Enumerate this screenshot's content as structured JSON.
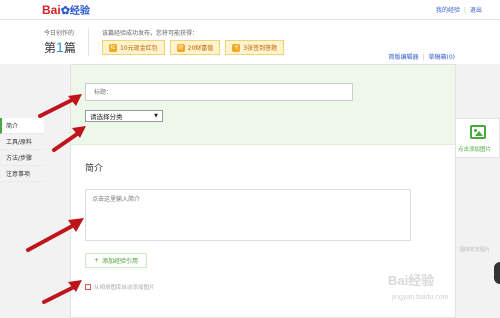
{
  "logo": {
    "brand": "Bai",
    "paw": "✿",
    "suffix": "经验"
  },
  "toplinks": {
    "my_exp": "我的经验",
    "logout": "退出"
  },
  "header": {
    "today_label": "今日创作的",
    "count_prefix": "第",
    "count_num": "1",
    "count_suffix": "篇",
    "hint": "该篇经验成功发布，您将可能获得：",
    "rewards": [
      {
        "icon": "红",
        "label": "10元现金红包"
      },
      {
        "icon": "财",
        "label": "20财富值"
      },
      {
        "icon": "卡",
        "label": "3张签到答题"
      }
    ],
    "simple_editor": "简版编辑器",
    "drafts": "草稿箱(0)"
  },
  "form": {
    "title_placeholder": "标题：",
    "category_label": "请选择分类",
    "category_arrow": "▼",
    "section_title": "简介",
    "intro_placeholder": "点击这里输入简介",
    "add_ref_plus": "+",
    "add_ref_label": "添加经验引用",
    "auto_add": "从相册图库自动添加图片"
  },
  "leftnav": {
    "items": [
      {
        "label": "简介",
        "active": true
      },
      {
        "label": "工具/原料",
        "active": false
      },
      {
        "label": "方法/步骤",
        "active": false
      },
      {
        "label": "注意事项",
        "active": false
      }
    ]
  },
  "rightpanel": {
    "add_pic": "点击添加图片",
    "no_pic": "图库暂无图片"
  },
  "watermark": {
    "brand": "Bai经验",
    "url": "jingyan.baidu.com"
  },
  "colors": {
    "accent_green": "#48a93c",
    "arrow_red": "#c0141c",
    "link_blue": "#2d5bd0"
  }
}
